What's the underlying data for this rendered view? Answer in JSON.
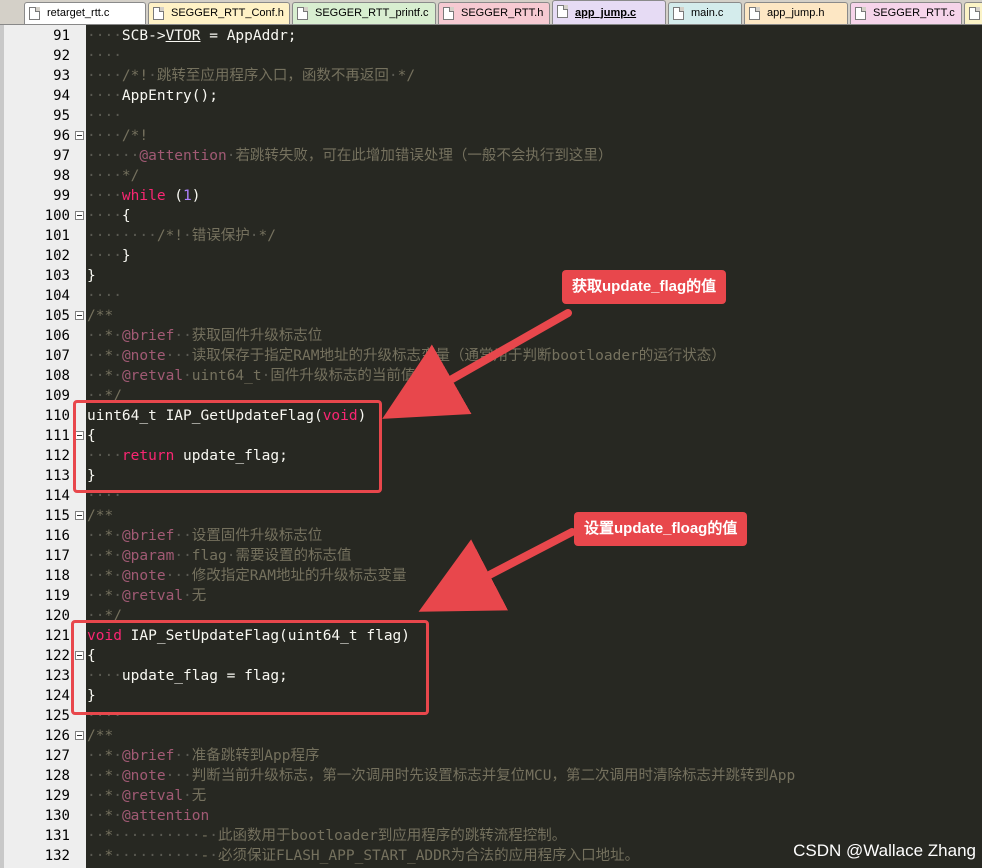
{
  "tabs": [
    {
      "label": "retarget_rtt.c",
      "color": "#ffffff",
      "active": false
    },
    {
      "label": "SEGGER_RTT_Conf.h",
      "color": "#fff2c6",
      "active": false
    },
    {
      "label": "SEGGER_RTT_printf.c",
      "color": "#d8eed0",
      "active": false
    },
    {
      "label": "SEGGER_RTT.h",
      "color": "#f6cad2",
      "active": false
    },
    {
      "label": "app_jump.c",
      "color": "#e6dbf4",
      "active": true
    },
    {
      "label": "main.c",
      "color": "#d4ecec",
      "active": false
    },
    {
      "label": "app_jump.h",
      "color": "#fde7c4",
      "active": false
    },
    {
      "label": "SEGGER_RTT.c",
      "color": "#f6d4ea",
      "active": false
    },
    {
      "label": "co",
      "color": "#fbf3c6",
      "active": false
    }
  ],
  "lines": [
    {
      "num": "91",
      "fold": false,
      "code": "    SCB->VTOR = AppAddr;"
    },
    {
      "num": "92",
      "fold": false,
      "code": ""
    },
    {
      "num": "93",
      "fold": false,
      "code": "    /*! 跳转至应用程序入口，函数不再返回 */"
    },
    {
      "num": "94",
      "fold": false,
      "code": "    AppEntry();"
    },
    {
      "num": "95",
      "fold": false,
      "code": ""
    },
    {
      "num": "96",
      "fold": true,
      "code": "    /*!"
    },
    {
      "num": "97",
      "fold": false,
      "code": "      @attention 若跳转失败，可在此增加错误处理（一般不会执行到这里）"
    },
    {
      "num": "98",
      "fold": false,
      "code": "    */"
    },
    {
      "num": "99",
      "fold": false,
      "code": "    while (1)"
    },
    {
      "num": "100",
      "fold": true,
      "code": "    {"
    },
    {
      "num": "101",
      "fold": false,
      "code": "        /*! 错误保护 */"
    },
    {
      "num": "102",
      "fold": false,
      "code": "    }"
    },
    {
      "num": "103",
      "fold": false,
      "code": "}"
    },
    {
      "num": "104",
      "fold": false,
      "code": ""
    },
    {
      "num": "105",
      "fold": true,
      "code": "/**"
    },
    {
      "num": "106",
      "fold": false,
      "code": "  * @brief  获取固件升级标志位"
    },
    {
      "num": "107",
      "fold": false,
      "code": "  * @note   读取保存于指定RAM地址的升级标志变量（通常用于判断bootloader的运行状态）"
    },
    {
      "num": "108",
      "fold": false,
      "code": "  * @retval uint64_t 固件升级标志的当前值"
    },
    {
      "num": "109",
      "fold": false,
      "code": "  */"
    },
    {
      "num": "110",
      "fold": false,
      "code": "uint64_t IAP_GetUpdateFlag(void)"
    },
    {
      "num": "111",
      "fold": true,
      "code": "{"
    },
    {
      "num": "112",
      "fold": false,
      "code": "    return update_flag;"
    },
    {
      "num": "113",
      "fold": false,
      "code": "}"
    },
    {
      "num": "114",
      "fold": false,
      "code": ""
    },
    {
      "num": "115",
      "fold": true,
      "code": "/**"
    },
    {
      "num": "116",
      "fold": false,
      "code": "  * @brief  设置固件升级标志位"
    },
    {
      "num": "117",
      "fold": false,
      "code": "  * @param  flag 需要设置的标志值"
    },
    {
      "num": "118",
      "fold": false,
      "code": "  * @note   修改指定RAM地址的升级标志变量"
    },
    {
      "num": "119",
      "fold": false,
      "code": "  * @retval 无"
    },
    {
      "num": "120",
      "fold": false,
      "code": "  */"
    },
    {
      "num": "121",
      "fold": false,
      "code": "void IAP_SetUpdateFlag(uint64_t flag)"
    },
    {
      "num": "122",
      "fold": true,
      "code": "{"
    },
    {
      "num": "123",
      "fold": false,
      "code": "    update_flag = flag;"
    },
    {
      "num": "124",
      "fold": false,
      "code": "}"
    },
    {
      "num": "125",
      "fold": false,
      "code": ""
    },
    {
      "num": "126",
      "fold": true,
      "code": "/**"
    },
    {
      "num": "127",
      "fold": false,
      "code": "  * @brief  准备跳转到App程序"
    },
    {
      "num": "128",
      "fold": false,
      "code": "  * @note   判断当前升级标志，第一次调用时先设置标志并复位MCU，第二次调用时清除标志并跳转到App"
    },
    {
      "num": "129",
      "fold": false,
      "code": "  * @retval 无"
    },
    {
      "num": "130",
      "fold": false,
      "code": "  * @attention"
    },
    {
      "num": "131",
      "fold": false,
      "code": "  *          - 此函数用于bootloader到应用程序的跳转流程控制。"
    },
    {
      "num": "132",
      "fold": false,
      "code": "  *          - 必须保证FLASH_APP_START_ADDR为合法的应用程序入口地址。"
    }
  ],
  "annotations": {
    "callout_get": "获取update_flag的值",
    "callout_set": "设置update_floag的值",
    "color": "#e8474c"
  },
  "watermark": "CSDN @Wallace Zhang"
}
